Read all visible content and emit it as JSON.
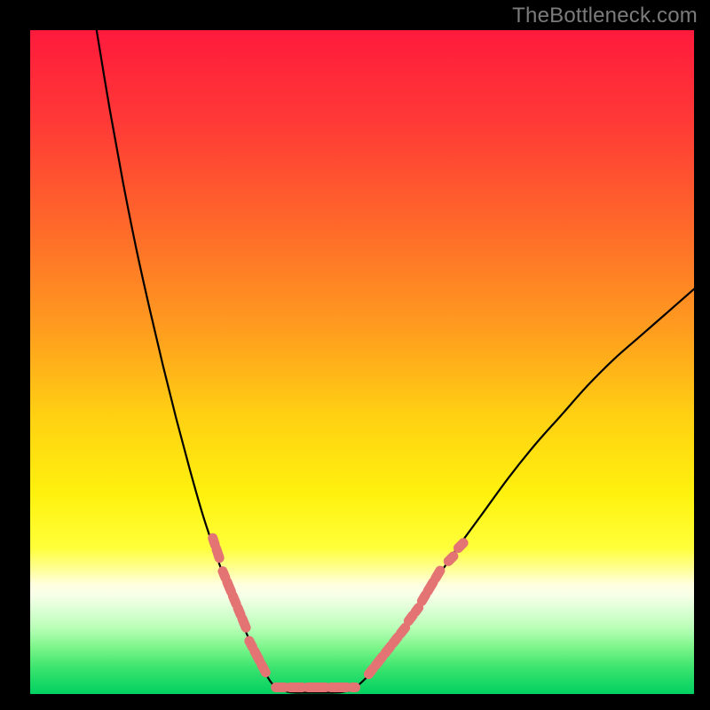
{
  "watermark": "TheBottleneck.com",
  "colors": {
    "salmon": "#e47373",
    "curve": "#000000",
    "gradient_stops": [
      {
        "offset": 0.0,
        "color": "#ff1a3c"
      },
      {
        "offset": 0.14,
        "color": "#ff3a36"
      },
      {
        "offset": 0.3,
        "color": "#ff6a2a"
      },
      {
        "offset": 0.46,
        "color": "#ffa01e"
      },
      {
        "offset": 0.58,
        "color": "#ffd012"
      },
      {
        "offset": 0.7,
        "color": "#fff20e"
      },
      {
        "offset": 0.78,
        "color": "#ffff3a"
      },
      {
        "offset": 0.815,
        "color": "#ffffa0"
      },
      {
        "offset": 0.835,
        "color": "#ffffe0"
      },
      {
        "offset": 0.85,
        "color": "#f8ffe8"
      },
      {
        "offset": 0.87,
        "color": "#e0ffd8"
      },
      {
        "offset": 0.9,
        "color": "#baffb8"
      },
      {
        "offset": 0.93,
        "color": "#7cf58a"
      },
      {
        "offset": 0.96,
        "color": "#3ce46e"
      },
      {
        "offset": 1.0,
        "color": "#00d060"
      }
    ]
  },
  "chart_data": {
    "type": "line",
    "title": "",
    "xlabel": "",
    "ylabel": "",
    "xlim": [
      0,
      100
    ],
    "ylim": [
      0,
      100
    ],
    "series": [
      {
        "name": "bottleneck-curve-left",
        "x": [
          10.0,
          12.0,
          14.0,
          16.0,
          18.0,
          20.0,
          22.0,
          24.0,
          26.0,
          28.0,
          30.0,
          32.0,
          34.0,
          35.5,
          37.0
        ],
        "y": [
          100.0,
          88.0,
          77.0,
          67.0,
          58.0,
          49.5,
          41.5,
          34.0,
          27.0,
          21.0,
          15.5,
          10.5,
          6.0,
          3.0,
          1.0
        ]
      },
      {
        "name": "bottleneck-curve-bottom",
        "x": [
          37.0,
          39.0,
          41.0,
          43.0,
          45.0,
          47.0,
          49.0
        ],
        "y": [
          1.0,
          0.3,
          0.2,
          0.2,
          0.2,
          0.3,
          1.0
        ]
      },
      {
        "name": "bottleneck-curve-right",
        "x": [
          49.0,
          52.0,
          56.0,
          60.0,
          64.0,
          68.0,
          72.0,
          76.0,
          80.0,
          84.0,
          88.0,
          92.0,
          96.0,
          100.0
        ],
        "y": [
          1.0,
          4.0,
          9.5,
          15.5,
          21.5,
          27.0,
          32.5,
          37.5,
          42.0,
          46.5,
          50.5,
          54.0,
          57.5,
          61.0
        ]
      },
      {
        "name": "salmon-markers",
        "note": "marker clusters along the curve; each entry is a contiguous dashed segment",
        "segments": [
          {
            "x": [
              27.5,
              28.5
            ],
            "y": [
              23.5,
              20.5
            ]
          },
          {
            "x": [
              29.0,
              32.5
            ],
            "y": [
              18.5,
              10.0
            ]
          },
          {
            "x": [
              33.0,
              35.5
            ],
            "y": [
              8.0,
              3.2
            ]
          },
          {
            "x": [
              37.0,
              49.0
            ],
            "y": [
              1.0,
              1.0
            ]
          },
          {
            "x": [
              51.0,
              56.5
            ],
            "y": [
              3.0,
              10.0
            ]
          },
          {
            "x": [
              57.0,
              58.5
            ],
            "y": [
              11.0,
              13.0
            ]
          },
          {
            "x": [
              59.0,
              62.0
            ],
            "y": [
              14.0,
              19.0
            ]
          },
          {
            "x": [
              63.0,
              64.0
            ],
            "y": [
              20.0,
              21.0
            ]
          },
          {
            "x": [
              64.5,
              65.5
            ],
            "y": [
              22.0,
              23.0
            ]
          }
        ]
      }
    ]
  }
}
